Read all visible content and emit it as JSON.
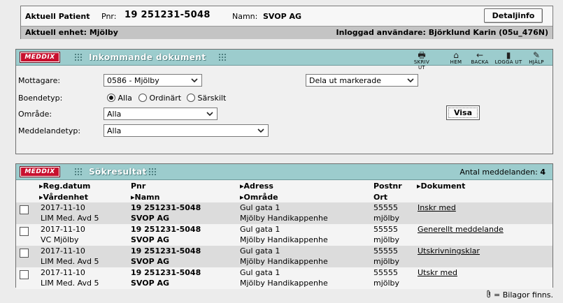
{
  "patient": {
    "heading": "Aktuell Patient",
    "pnr_label": "Pnr:",
    "pnr": "19 251231-5048",
    "name_label": "Namn:",
    "name": "SVOP AG",
    "detail_button": "Detaljinfo",
    "unit_text": "Aktuell enhet: Mjölby",
    "user_text": "Inloggad användare: Björklund Karin (05u_476N)"
  },
  "incoming": {
    "logo": "MEDDIX",
    "title": "Inkommande dokument",
    "toolbar": [
      {
        "icon": "printer-icon",
        "glyph": "🖶",
        "label": "SKRIV UT"
      },
      {
        "icon": "home-icon",
        "glyph": "⌂",
        "label": "HEM"
      },
      {
        "icon": "back-arrow-icon",
        "glyph": "←",
        "label": "BACKA"
      },
      {
        "icon": "logout-door-icon",
        "glyph": "▮",
        "label": "LOGGA UT"
      },
      {
        "icon": "help-book-icon",
        "glyph": "✎",
        "label": "HJÄLP"
      }
    ],
    "form": {
      "mottagare_label": "Mottagare:",
      "mottagare_value": "0586 - Mjölby",
      "action_value": "Dela ut markerade",
      "boendetyp_label": "Boendetyp:",
      "radio_options": [
        "Alla",
        "Ordinärt",
        "Särskilt"
      ],
      "omrade_label": "Område:",
      "omrade_value": "Alla",
      "meddelandetyp_label": "Meddelandetyp:",
      "meddelandetyp_value": "Alla",
      "visa_button": "Visa"
    }
  },
  "results": {
    "logo": "MEDDIX",
    "title": "Sökresultat",
    "count_label": "Antal meddelanden:",
    "count": "4",
    "headers": {
      "regdatum": "Reg.datum",
      "vardenhet": "Vårdenhet",
      "pnr": "Pnr",
      "namn": "Namn",
      "adress": "Adress",
      "omrade": "Område",
      "postnr": "Postnr",
      "ort": "Ort",
      "dokument": "Dokument"
    },
    "rows": [
      {
        "date": "2017-11-10",
        "unit": "LIM Med. Avd 5",
        "pnr": "19 251231-5048",
        "name": "SVOP AG",
        "address": "Gul gata 1",
        "area": "Mjölby Handikappenhe",
        "postnr": "55555",
        "ort": "mjölby",
        "doc": "Inskr med"
      },
      {
        "date": "2017-11-10",
        "unit": "VC Mjölby",
        "pnr": "19 251231-5048",
        "name": "SVOP AG",
        "address": "Gul gata 1",
        "area": "Mjölby Handikappenhe",
        "postnr": "55555",
        "ort": "mjölby",
        "doc": "Generellt meddelande"
      },
      {
        "date": "2017-11-10",
        "unit": "LIM Med. Avd 5",
        "pnr": "19 251231-5048",
        "name": "SVOP AG",
        "address": "Gul gata 1",
        "area": "Mjölby Handikappenhe",
        "postnr": "55555",
        "ort": "mjölby",
        "doc": "Utskrivningsklar"
      },
      {
        "date": "2017-11-10",
        "unit": "LIM Med. Avd 5",
        "pnr": "19 251231-5048",
        "name": "SVOP AG",
        "address": "Gul gata 1",
        "area": "Mjölby Handikappenhe",
        "postnr": "55555",
        "ort": "mjölby",
        "doc": "Utskr med"
      }
    ]
  },
  "footer": {
    "icon": "paperclip-icon",
    "text": "= Bilagor finns."
  },
  "colors": {
    "panel_header": "#9ccccd",
    "logo_red": "#c8102e",
    "row_shade": "#dcdcdc"
  }
}
